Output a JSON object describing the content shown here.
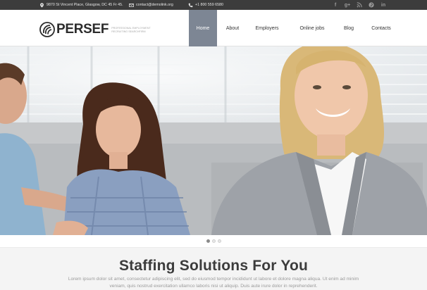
{
  "topbar": {
    "address": "9870 St Vincent Place, Glasgow, DC 45 Fr 45.",
    "email": "contact@demolink.org",
    "phone": "+1 800 559 6580",
    "social": [
      {
        "icon": "facebook-icon",
        "glyph": "f"
      },
      {
        "icon": "google-plus-icon",
        "glyph": "g+"
      },
      {
        "icon": "rss-icon",
        "glyph": ")"
      },
      {
        "icon": "pinterest-icon",
        "glyph": "P"
      },
      {
        "icon": "linkedin-icon",
        "glyph": "in"
      }
    ]
  },
  "logo": {
    "name": "PERSEF",
    "tagline": "Professional Employment Recruiting Searchfirm"
  },
  "nav": [
    {
      "label": "Home",
      "active": true
    },
    {
      "label": "About",
      "active": false
    },
    {
      "label": "Employers",
      "active": false
    },
    {
      "label": "Online jobs",
      "active": false
    },
    {
      "label": "Blog",
      "active": false
    },
    {
      "label": "Contacts",
      "active": false
    }
  ],
  "slider": {
    "slides": 3,
    "active_index": 0
  },
  "intro": {
    "heading": "Staffing Solutions For You",
    "text": "Lorem ipsum dolor sit amet, consectetur adipiscing elit, sed do eiusmod tempor incididunt ut labore et dolore magna aliqua. Ut enim ad minim veniam, quis nostrud exercitation ullamco laboris nisi ut aliquip. Duis aute irure dolor in reprehenderit."
  },
  "colors": {
    "topbar_bg": "#3c3c3c",
    "nav_active_bg": "#7d8694",
    "heading": "#3c3c3c",
    "body_text": "#9a9a9a"
  }
}
